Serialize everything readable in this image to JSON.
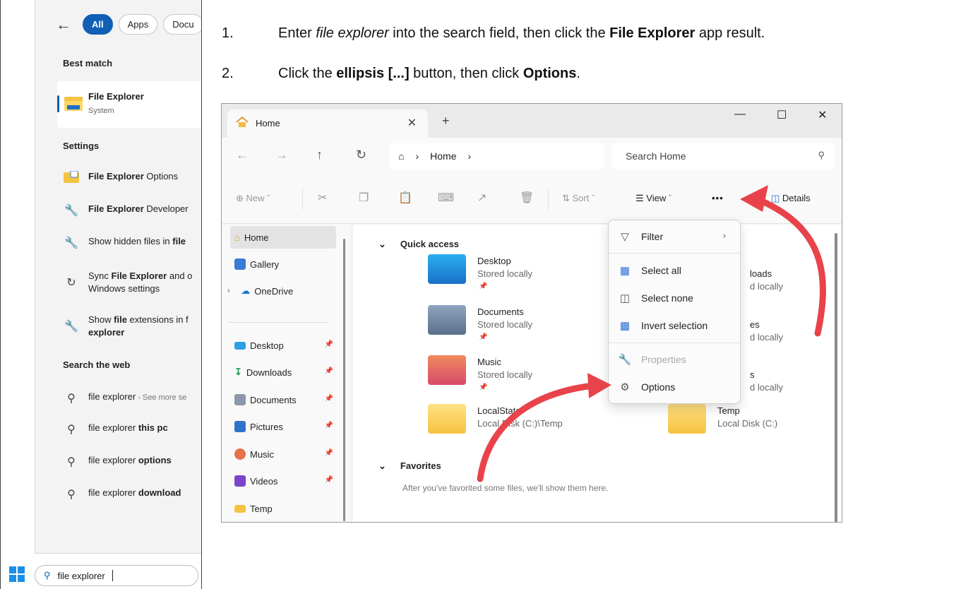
{
  "search_panel": {
    "filters": [
      "All",
      "Apps",
      "Docu"
    ],
    "best_match_heading": "Best match",
    "best_match": {
      "title": "File Explorer",
      "subtitle": "System"
    },
    "settings_heading": "Settings",
    "settings": [
      {
        "bold": "File Explorer",
        "rest": " Options"
      },
      {
        "bold": "File Explorer",
        "rest": " Developer"
      },
      {
        "pre": "Show hidden files in ",
        "bold": "file"
      },
      {
        "pre": "Sync ",
        "bold": "File Explorer",
        "rest": " and o",
        "line2": "Windows settings"
      },
      {
        "pre": "Show ",
        "bold": "file",
        "rest": " extensions in f",
        "line2": "explorer"
      }
    ],
    "web_heading": "Search the web",
    "web": [
      {
        "text": "file explorer",
        "extra": " - See more se"
      },
      {
        "text": "file explorer ",
        "bold": "this pc"
      },
      {
        "text": "file explorer ",
        "bold": "options"
      },
      {
        "text": "file explorer ",
        "bold": "download"
      }
    ],
    "taskbar_query": "file explorer"
  },
  "instructions": [
    {
      "num": "1.",
      "p1": "Enter ",
      "i1": "file explorer",
      "p2": " into the search field, then click the ",
      "b1": "File Explorer",
      "p3": " app result."
    },
    {
      "num": "2.",
      "p1": "Click the ",
      "b1": "ellipsis [...]",
      "p2": " button, then click ",
      "b2": "Options",
      "p3": "."
    }
  ],
  "explorer": {
    "tab_title": "Home",
    "address": {
      "root": "Home"
    },
    "search_placeholder": "Search Home",
    "commands": {
      "new": "New",
      "sort": "Sort",
      "view": "View",
      "more": "•••",
      "details": "Details"
    },
    "nav": [
      {
        "label": "Home",
        "icon": "home-icon"
      },
      {
        "label": "Gallery",
        "icon": "gallery-icon"
      },
      {
        "label": "OneDrive",
        "icon": "cloud-icon"
      },
      {
        "label": "Desktop",
        "icon": "desktop-icon"
      },
      {
        "label": "Downloads",
        "icon": "download-icon"
      },
      {
        "label": "Documents",
        "icon": "documents-icon"
      },
      {
        "label": "Pictures",
        "icon": "pictures-icon"
      },
      {
        "label": "Music",
        "icon": "music-icon"
      },
      {
        "label": "Videos",
        "icon": "videos-icon"
      },
      {
        "label": "Temp",
        "icon": "folder-icon"
      }
    ],
    "quick_access_heading": "Quick access",
    "folders": [
      {
        "name": "Desktop",
        "sub": "Stored locally"
      },
      {
        "name": "Documents",
        "sub": "Stored locally"
      },
      {
        "name": "Music",
        "sub": "Stored locally"
      },
      {
        "name": "LocalState",
        "sub": "Local Disk (C:)\\Temp"
      },
      {
        "name": "loads",
        "sub": "d locally"
      },
      {
        "name": "es",
        "sub": "d locally"
      },
      {
        "name": "s",
        "sub": "d locally"
      },
      {
        "name": "Temp",
        "sub": "Local Disk (C:)"
      }
    ],
    "favorites_heading": "Favorites",
    "favorites_note": "After you've favorited some files, we'll show them here."
  },
  "menu": {
    "items": [
      "Filter",
      "Select all",
      "Select none",
      "Invert selection",
      "Properties",
      "Options"
    ]
  },
  "colors": {
    "accent": "#0f5fb5",
    "arrow": "#e8434b"
  }
}
